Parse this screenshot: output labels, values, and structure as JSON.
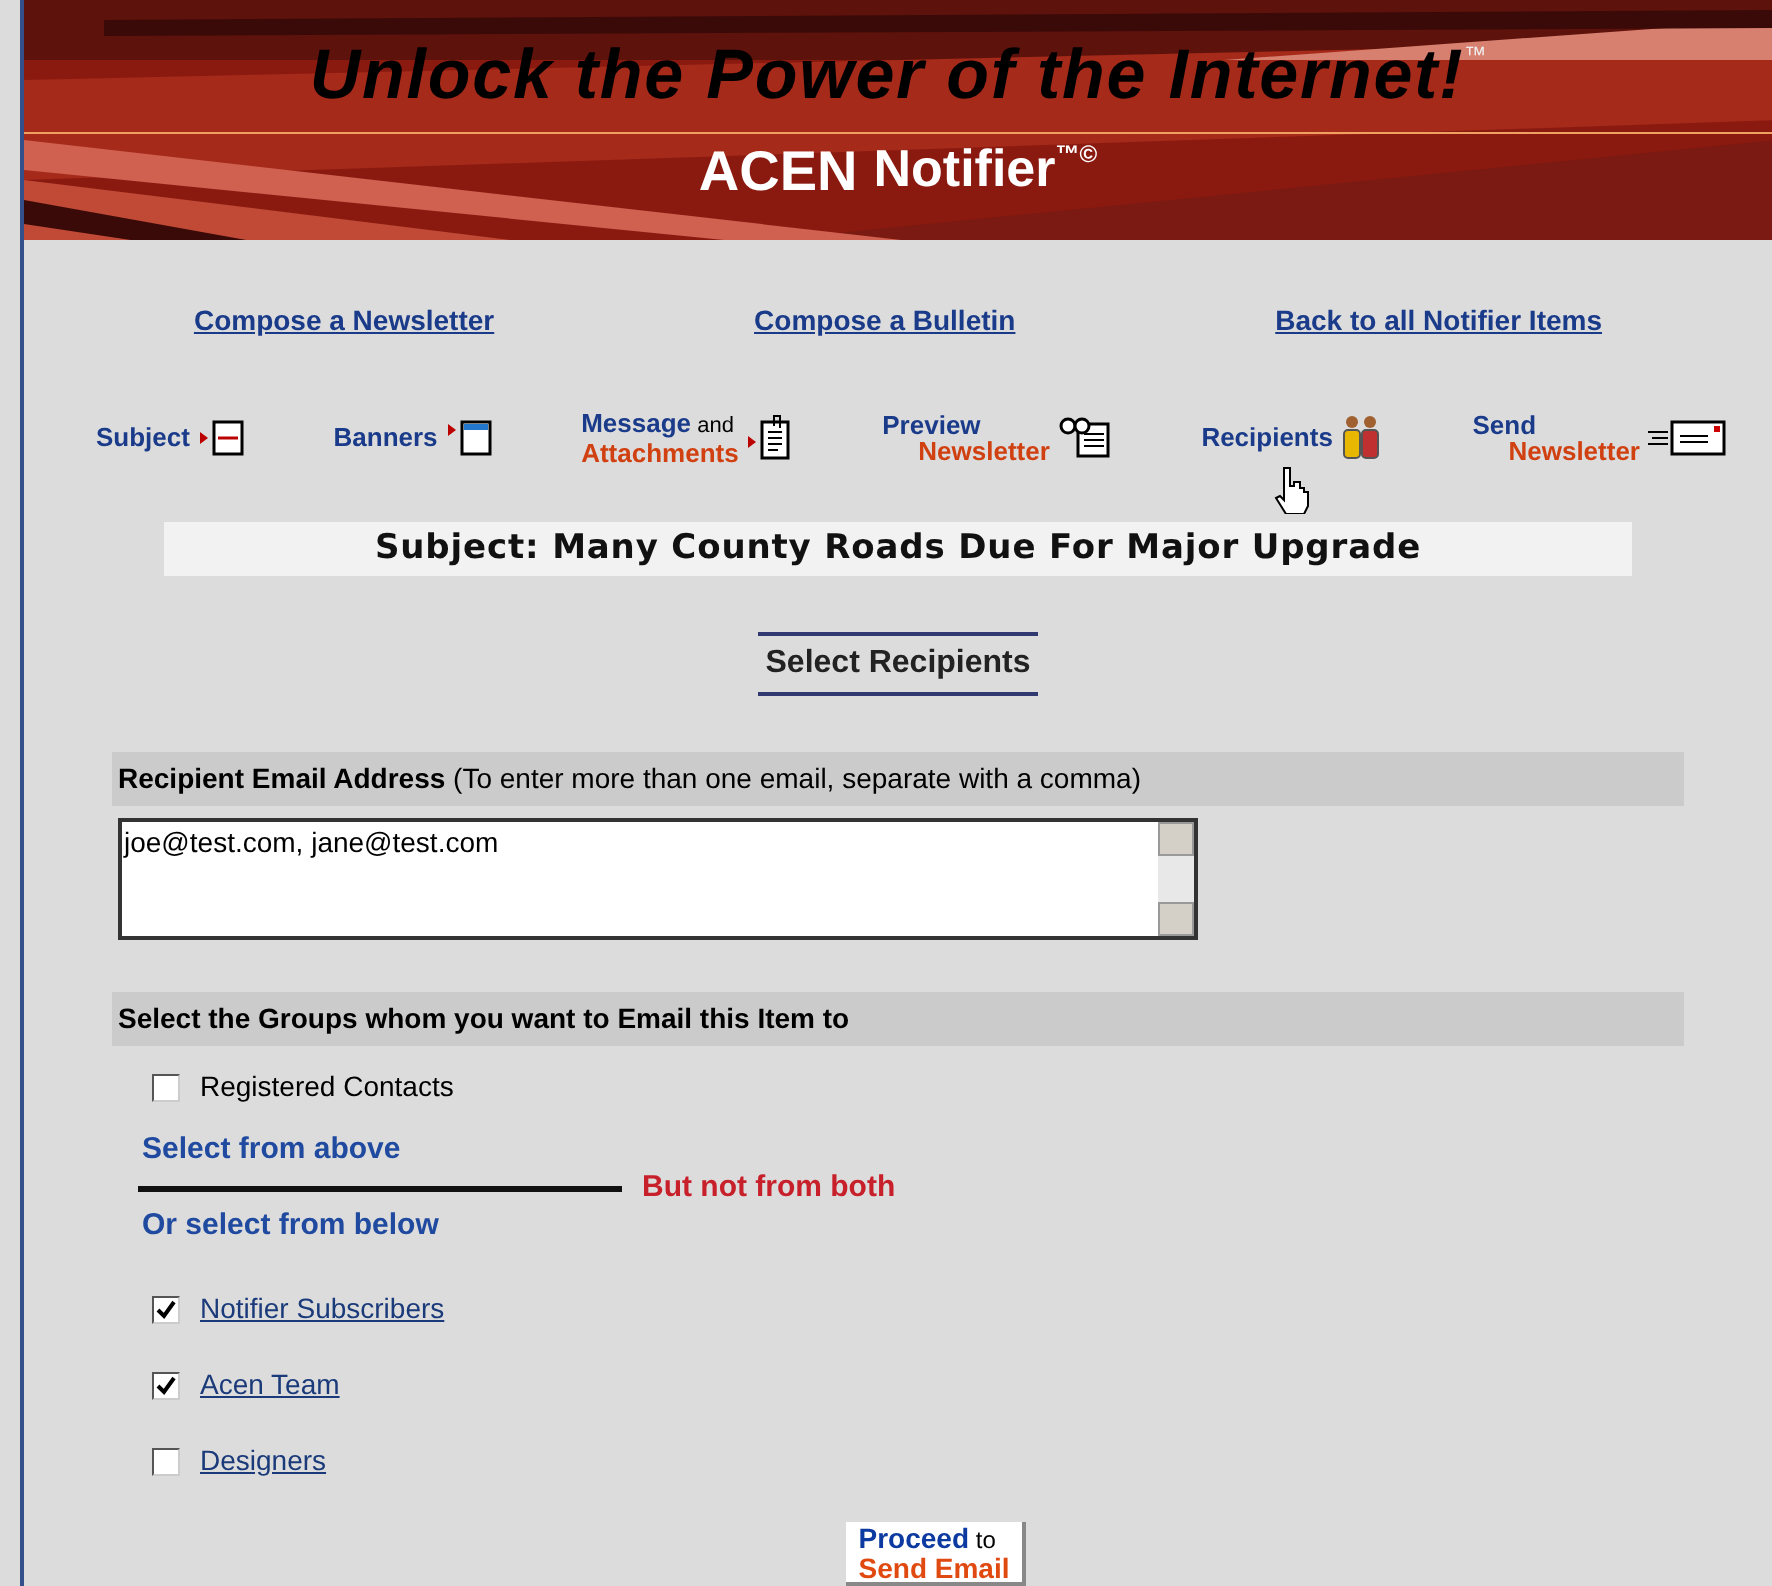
{
  "banner": {
    "title": "Unlock the Power of the Internet!",
    "title_mark": "™",
    "brand": "ACEN",
    "product": "Notifier",
    "product_mark": "™©"
  },
  "links": [
    "Compose a Newsletter",
    "Compose a Bulletin",
    "Back to all Notifier Items"
  ],
  "steps": [
    {
      "top": "Subject",
      "kind": "subject",
      "hovered": false
    },
    {
      "top": "Banners",
      "kind": "banner",
      "hovered": false
    },
    {
      "top": "Message",
      "small": "and",
      "bottom": "Attachments",
      "kind": "document",
      "hovered": false
    },
    {
      "top": "Preview",
      "bottom": "Newsletter",
      "kind": "preview",
      "hovered": false
    },
    {
      "top": "Recipients",
      "kind": "people",
      "hovered": true
    },
    {
      "top": "Send",
      "bottom": "Newsletter",
      "kind": "envelope",
      "hovered": false
    }
  ],
  "subject": "Subject: Many County Roads Due For Major Upgrade",
  "heading": "Select Recipients",
  "email_section": {
    "label": "Recipient Email Address",
    "hint": "(To enter more than one email, separate with a comma)",
    "value": "joe@test.com, jane@test.com"
  },
  "groups_section": {
    "heading": "Select the Groups whom you want to Email this Item to",
    "top_options": [
      {
        "label": "Registered Contacts",
        "checked": false
      }
    ],
    "above_label": "Select from above",
    "warning": "But not from both",
    "below_label": "Or select from below",
    "bottom_options": [
      {
        "label": "Notifier Subscribers",
        "checked": true
      },
      {
        "label": "Acen Team",
        "checked": true
      },
      {
        "label": "Designers",
        "checked": false
      }
    ]
  },
  "proceed": {
    "top": "Proceed",
    "small": "to",
    "bottom": "Send Email"
  }
}
